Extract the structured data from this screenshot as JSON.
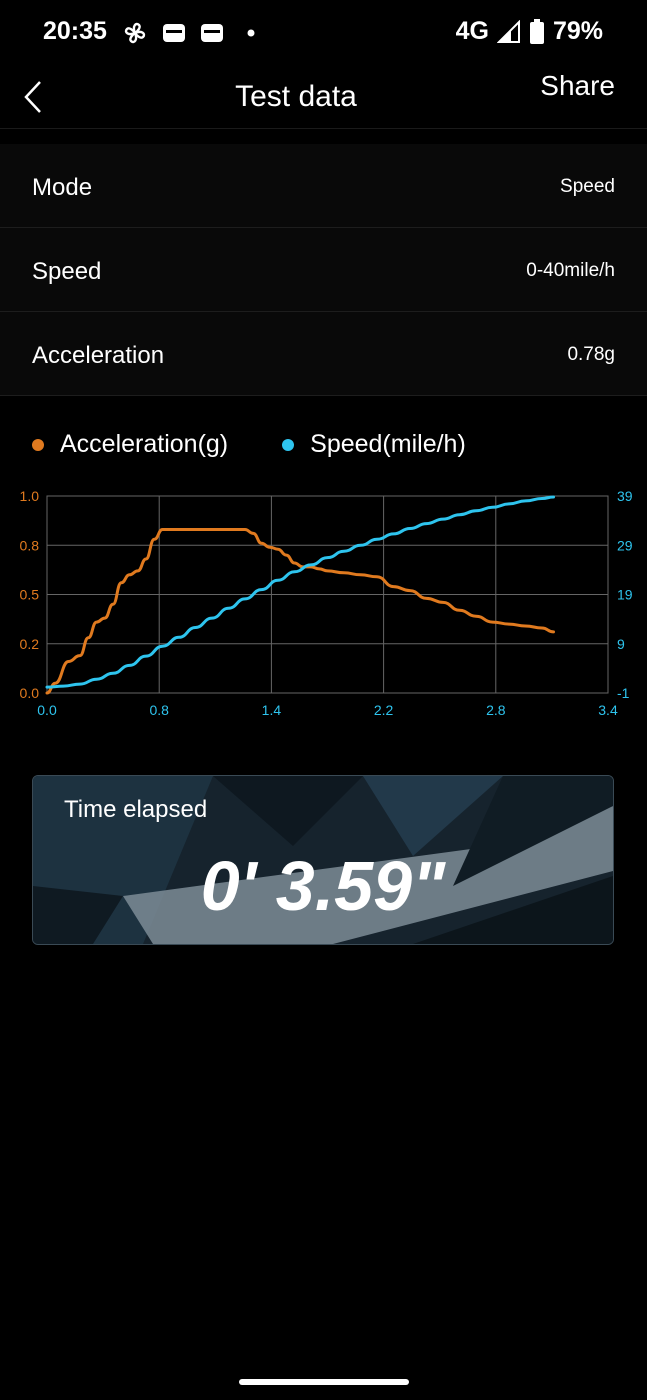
{
  "status": {
    "time": "20:35",
    "network": "4G",
    "battery": "79%",
    "icons": [
      "fan-icon",
      "wallet-icon",
      "wallet-icon",
      "dot-icon",
      "signal-icon",
      "battery-icon"
    ]
  },
  "header": {
    "title": "Test data",
    "share_label": "Share",
    "back_icon": "chevron-left-icon"
  },
  "info": [
    {
      "label": "Mode",
      "value": "Speed"
    },
    {
      "label": "Speed",
      "value": "0-40mile/h"
    },
    {
      "label": "Acceleration",
      "value": "0.78g"
    }
  ],
  "colors": {
    "acceleration": "#e07a1f",
    "speed": "#2ec4ee",
    "grid": "#666666"
  },
  "chart_data": {
    "type": "line",
    "xlabel": "",
    "x_ticks": [
      "0.0",
      "0.8",
      "1.4",
      "2.2",
      "2.8",
      "3.4"
    ],
    "xlim": [
      0.0,
      3.4
    ],
    "left_axis": {
      "ticks": [
        "1.0",
        "0.8",
        "0.5",
        "0.2",
        "0.0"
      ],
      "ylim": [
        0.0,
        1.0
      ]
    },
    "right_axis": {
      "ticks": [
        "39",
        "29",
        "19",
        "9",
        "-1"
      ],
      "ylim": [
        -1,
        39
      ]
    },
    "grid": true,
    "legend_position": "top-left",
    "series": [
      {
        "name": "Acceleration(g)",
        "axis": "left",
        "x": [
          0.0,
          0.05,
          0.13,
          0.2,
          0.25,
          0.3,
          0.35,
          0.4,
          0.45,
          0.5,
          0.55,
          0.6,
          0.65,
          0.7,
          0.75,
          0.8,
          0.85,
          0.9,
          1.0,
          1.1,
          1.2,
          1.25,
          1.3,
          1.35,
          1.4,
          1.45,
          1.5,
          1.55,
          1.6,
          1.65,
          1.7,
          1.8,
          1.9,
          2.0,
          2.1,
          2.2,
          2.3,
          2.4,
          2.5,
          2.6,
          2.7,
          2.8,
          2.9,
          3.0,
          3.07
        ],
        "values": [
          0.0,
          0.05,
          0.16,
          0.19,
          0.28,
          0.36,
          0.38,
          0.45,
          0.56,
          0.6,
          0.62,
          0.68,
          0.78,
          0.83,
          0.83,
          0.83,
          0.83,
          0.83,
          0.83,
          0.83,
          0.83,
          0.81,
          0.76,
          0.74,
          0.73,
          0.7,
          0.66,
          0.64,
          0.64,
          0.63,
          0.62,
          0.61,
          0.6,
          0.59,
          0.54,
          0.52,
          0.48,
          0.46,
          0.42,
          0.39,
          0.36,
          0.35,
          0.34,
          0.33,
          0.31
        ]
      },
      {
        "name": "Speed(mile/h)",
        "axis": "right",
        "x": [
          0.0,
          0.1,
          0.2,
          0.3,
          0.4,
          0.5,
          0.6,
          0.7,
          0.8,
          0.9,
          1.0,
          1.1,
          1.2,
          1.3,
          1.4,
          1.5,
          1.6,
          1.7,
          1.8,
          1.9,
          2.0,
          2.1,
          2.2,
          2.3,
          2.4,
          2.5,
          2.6,
          2.7,
          2.8,
          2.9,
          3.0,
          3.07
        ],
        "values": [
          0.2,
          0.4,
          0.8,
          1.8,
          3.0,
          4.6,
          6.5,
          8.5,
          10.3,
          12.3,
          14.2,
          16.2,
          18.1,
          20.0,
          21.9,
          23.6,
          25.0,
          26.5,
          27.8,
          29.0,
          30.2,
          31.3,
          32.4,
          33.4,
          34.3,
          35.2,
          36.0,
          36.7,
          37.4,
          38.0,
          38.5,
          38.8
        ]
      }
    ]
  },
  "timer": {
    "label": "Time elapsed",
    "value": "0' 3.59\""
  }
}
